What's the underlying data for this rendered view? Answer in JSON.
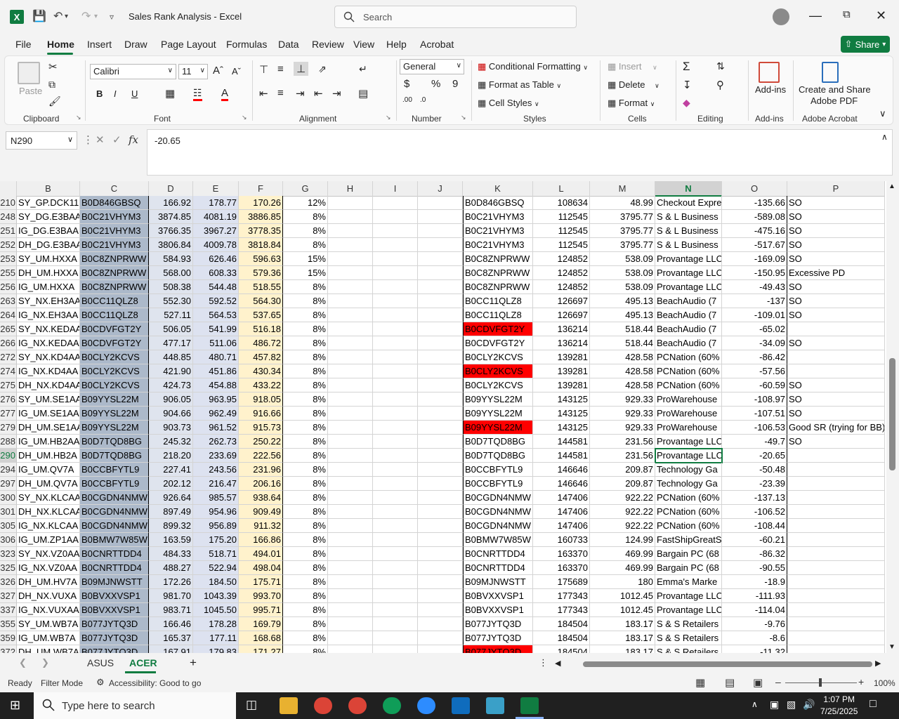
{
  "window": {
    "title": "Sales Rank Analysis  -  Excel",
    "search_placeholder": "Search"
  },
  "menu": {
    "items": [
      "File",
      "Home",
      "Insert",
      "Draw",
      "Page Layout",
      "Formulas",
      "Data",
      "Review",
      "View",
      "Help",
      "Acrobat"
    ],
    "active": "Home",
    "share": "Share"
  },
  "ribbon": {
    "clipboard": {
      "label": "Clipboard",
      "paste": "Paste"
    },
    "font": {
      "label": "Font",
      "name": "Calibri",
      "size": "11"
    },
    "alignment": {
      "label": "Alignment"
    },
    "number": {
      "label": "Number",
      "format": "General"
    },
    "styles": {
      "label": "Styles",
      "conditional": "Conditional Formatting",
      "format_table": "Format as Table",
      "cell_styles": "Cell Styles"
    },
    "cells": {
      "label": "Cells",
      "insert": "Insert",
      "delete": "Delete",
      "format": "Format"
    },
    "editing": {
      "label": "Editing"
    },
    "addins": {
      "label": "Add-ins",
      "button": "Add-ins"
    },
    "acrobat": {
      "label": "Adobe Acrobat",
      "button_line1": "Create and Share",
      "button_line2": "Adobe PDF"
    }
  },
  "formula_bar": {
    "name_box": "N290",
    "value": "-20.65"
  },
  "columns": [
    "B",
    "C",
    "D",
    "E",
    "F",
    "G",
    "H",
    "I",
    "J",
    "K",
    "L",
    "M",
    "N",
    "O",
    "P"
  ],
  "selected_column": "N",
  "selected_row": "290",
  "rows": [
    {
      "row": "210",
      "B": "SY_GP.DCK11.",
      "C": "B0D846GBSQ",
      "D": "166.92",
      "E": "178.77",
      "F": "170.26",
      "G": "12%",
      "K": "B0D846GBSQ",
      "L": "108634",
      "M": "48.99",
      "N": "Checkout Expre",
      "O": "-135.66",
      "P": "SO",
      "kred": false
    },
    {
      "row": "248",
      "B": "SY_DG.E3BAA",
      "C": "B0C21VHYM3",
      "D": "3874.85",
      "E": "4081.19",
      "F": "3886.85",
      "G": "8%",
      "K": "B0C21VHYM3",
      "L": "112545",
      "M": "3795.77",
      "N": "S & L Business",
      "O": "-589.08",
      "P": "SO",
      "kred": false
    },
    {
      "row": "251",
      "B": "IG_DG.E3BAA",
      "C": "B0C21VHYM3",
      "D": "3766.35",
      "E": "3967.27",
      "F": "3778.35",
      "G": "8%",
      "K": "B0C21VHYM3",
      "L": "112545",
      "M": "3795.77",
      "N": "S & L Business",
      "O": "-475.16",
      "P": "SO",
      "kred": false
    },
    {
      "row": "252",
      "B": "DH_DG.E3BAA",
      "C": "B0C21VHYM3",
      "D": "3806.84",
      "E": "4009.78",
      "F": "3818.84",
      "G": "8%",
      "K": "B0C21VHYM3",
      "L": "112545",
      "M": "3795.77",
      "N": "S & L Business",
      "O": "-517.67",
      "P": "SO",
      "kred": false
    },
    {
      "row": "253",
      "B": "SY_UM.HXXA",
      "C": "B0C8ZNPRWW",
      "D": "584.93",
      "E": "626.46",
      "F": "596.63",
      "G": "15%",
      "K": "B0C8ZNPRWW",
      "L": "124852",
      "M": "538.09",
      "N": "Provantage LLC",
      "O": "-169.09",
      "P": "SO",
      "kred": false
    },
    {
      "row": "255",
      "B": "DH_UM.HXXA",
      "C": "B0C8ZNPRWW",
      "D": "568.00",
      "E": "608.33",
      "F": "579.36",
      "G": "15%",
      "K": "B0C8ZNPRWW",
      "L": "124852",
      "M": "538.09",
      "N": "Provantage LLC",
      "O": "-150.95",
      "P": "Excessive PD",
      "kred": false
    },
    {
      "row": "256",
      "B": "IG_UM.HXXA",
      "C": "B0C8ZNPRWW",
      "D": "508.38",
      "E": "544.48",
      "F": "518.55",
      "G": "8%",
      "K": "B0C8ZNPRWW",
      "L": "124852",
      "M": "538.09",
      "N": "Provantage LLC",
      "O": "-49.43",
      "P": "SO",
      "kred": false
    },
    {
      "row": "263",
      "B": "SY_NX.EH3AA",
      "C": "B0CC11QLZ8",
      "D": "552.30",
      "E": "592.52",
      "F": "564.30",
      "G": "8%",
      "K": "B0CC11QLZ8",
      "L": "126697",
      "M": "495.13",
      "N": "BeachAudio (7",
      "O": "-137",
      "P": "SO",
      "kred": false
    },
    {
      "row": "264",
      "B": "IG_NX.EH3AA",
      "C": "B0CC11QLZ8",
      "D": "527.11",
      "E": "564.53",
      "F": "537.65",
      "G": "8%",
      "K": "B0CC11QLZ8",
      "L": "126697",
      "M": "495.13",
      "N": "BeachAudio (7",
      "O": "-109.01",
      "P": "SO",
      "kred": false
    },
    {
      "row": "265",
      "B": "SY_NX.KEDAA",
      "C": "B0CDVFGT2Y",
      "D": "506.05",
      "E": "541.99",
      "F": "516.18",
      "G": "8%",
      "K": "B0CDVFGT2Y",
      "L": "136214",
      "M": "518.44",
      "N": "BeachAudio (7",
      "O": "-65.02",
      "P": "",
      "kred": true
    },
    {
      "row": "266",
      "B": "IG_NX.KEDAA",
      "C": "B0CDVFGT2Y",
      "D": "477.17",
      "E": "511.06",
      "F": "486.72",
      "G": "8%",
      "K": "B0CDVFGT2Y",
      "L": "136214",
      "M": "518.44",
      "N": "BeachAudio (7",
      "O": "-34.09",
      "P": "SO",
      "kred": false
    },
    {
      "row": "272",
      "B": "SY_NX.KD4AA",
      "C": "B0CLY2KCVS",
      "D": "448.85",
      "E": "480.71",
      "F": "457.82",
      "G": "8%",
      "K": "B0CLY2KCVS",
      "L": "139281",
      "M": "428.58",
      "N": "PCNation (60%",
      "O": "-86.42",
      "P": "",
      "kred": false
    },
    {
      "row": "274",
      "B": "IG_NX.KD4AA",
      "C": "B0CLY2KCVS",
      "D": "421.90",
      "E": "451.86",
      "F": "430.34",
      "G": "8%",
      "K": "B0CLY2KCVS",
      "L": "139281",
      "M": "428.58",
      "N": "PCNation (60%",
      "O": "-57.56",
      "P": "",
      "kred": true
    },
    {
      "row": "275",
      "B": "DH_NX.KD4AA",
      "C": "B0CLY2KCVS",
      "D": "424.73",
      "E": "454.88",
      "F": "433.22",
      "G": "8%",
      "K": "B0CLY2KCVS",
      "L": "139281",
      "M": "428.58",
      "N": "PCNation (60%",
      "O": "-60.59",
      "P": "SO",
      "kred": false
    },
    {
      "row": "276",
      "B": "SY_UM.SE1AA",
      "C": "B09YYSL22M",
      "D": "906.05",
      "E": "963.95",
      "F": "918.05",
      "G": "8%",
      "K": "B09YYSL22M",
      "L": "143125",
      "M": "929.33",
      "N": "ProWarehouse",
      "O": "-108.97",
      "P": "SO",
      "kred": false
    },
    {
      "row": "277",
      "B": "IG_UM.SE1AA",
      "C": "B09YYSL22M",
      "D": "904.66",
      "E": "962.49",
      "F": "916.66",
      "G": "8%",
      "K": "B09YYSL22M",
      "L": "143125",
      "M": "929.33",
      "N": "ProWarehouse",
      "O": "-107.51",
      "P": "SO",
      "kred": false
    },
    {
      "row": "279",
      "B": "DH_UM.SE1AA",
      "C": "B09YYSL22M",
      "D": "903.73",
      "E": "961.52",
      "F": "915.73",
      "G": "8%",
      "K": "B09YYSL22M",
      "L": "143125",
      "M": "929.33",
      "N": "ProWarehouse",
      "O": "-106.53",
      "P": "Good SR (trying for BB)",
      "kred": true
    },
    {
      "row": "288",
      "B": "IG_UM.HB2AA",
      "C": "B0D7TQD8BG",
      "D": "245.32",
      "E": "262.73",
      "F": "250.22",
      "G": "8%",
      "K": "B0D7TQD8BG",
      "L": "144581",
      "M": "231.56",
      "N": "Provantage LLC",
      "O": "-49.7",
      "P": "SO",
      "kred": false
    },
    {
      "row": "290",
      "B": "DH_UM.HB2A",
      "C": "B0D7TQD8BG",
      "D": "218.20",
      "E": "233.69",
      "F": "222.56",
      "G": "8%",
      "K": "B0D7TQD8BG",
      "L": "144581",
      "M": "231.56",
      "N": "Provantage LLC",
      "O": "-20.65",
      "P": "",
      "kred": false
    },
    {
      "row": "294",
      "B": "IG_UM.QV7A",
      "C": "B0CCBFYTL9",
      "D": "227.41",
      "E": "243.56",
      "F": "231.96",
      "G": "8%",
      "K": "B0CCBFYTL9",
      "L": "146646",
      "M": "209.87",
      "N": "Technology Ga",
      "O": "-50.48",
      "P": "",
      "kred": false
    },
    {
      "row": "297",
      "B": "DH_UM.QV7A",
      "C": "B0CCBFYTL9",
      "D": "202.12",
      "E": "216.47",
      "F": "206.16",
      "G": "8%",
      "K": "B0CCBFYTL9",
      "L": "146646",
      "M": "209.87",
      "N": "Technology Ga",
      "O": "-23.39",
      "P": "",
      "kred": false
    },
    {
      "row": "300",
      "B": "SY_NX.KLCAA",
      "C": "B0CGDN4NMW",
      "D": "926.64",
      "E": "985.57",
      "F": "938.64",
      "G": "8%",
      "K": "B0CGDN4NMW",
      "L": "147406",
      "M": "922.22",
      "N": "PCNation (60%",
      "O": "-137.13",
      "P": "",
      "kred": false
    },
    {
      "row": "301",
      "B": "DH_NX.KLCAA",
      "C": "B0CGDN4NMW",
      "D": "897.49",
      "E": "954.96",
      "F": "909.49",
      "G": "8%",
      "K": "B0CGDN4NMW",
      "L": "147406",
      "M": "922.22",
      "N": "PCNation (60%",
      "O": "-106.52",
      "P": "",
      "kred": false
    },
    {
      "row": "305",
      "B": "IG_NX.KLCAA",
      "C": "B0CGDN4NMW",
      "D": "899.32",
      "E": "956.89",
      "F": "911.32",
      "G": "8%",
      "K": "B0CGDN4NMW",
      "L": "147406",
      "M": "922.22",
      "N": "PCNation (60%",
      "O": "-108.44",
      "P": "",
      "kred": false
    },
    {
      "row": "306",
      "B": "IG_UM.ZP1AA",
      "C": "B0BMW7W85W",
      "D": "163.59",
      "E": "175.20",
      "F": "166.86",
      "G": "8%",
      "K": "B0BMW7W85W",
      "L": "160733",
      "M": "124.99",
      "N": "FastShipGreatS",
      "O": "-60.21",
      "P": "",
      "kred": false
    },
    {
      "row": "323",
      "B": "SY_NX.VZ0AA",
      "C": "B0CNRTTDD4",
      "D": "484.33",
      "E": "518.71",
      "F": "494.01",
      "G": "8%",
      "K": "B0CNRTTDD4",
      "L": "163370",
      "M": "469.99",
      "N": "Bargain PC (68",
      "O": "-86.32",
      "P": "",
      "kred": false
    },
    {
      "row": "325",
      "B": "IG_NX.VZ0AA",
      "C": "B0CNRTTDD4",
      "D": "488.27",
      "E": "522.94",
      "F": "498.04",
      "G": "8%",
      "K": "B0CNRTTDD4",
      "L": "163370",
      "M": "469.99",
      "N": "Bargain PC (68",
      "O": "-90.55",
      "P": "",
      "kred": false
    },
    {
      "row": "326",
      "B": "DH_UM.HV7A",
      "C": "B09MJNWSTT",
      "D": "172.26",
      "E": "184.50",
      "F": "175.71",
      "G": "8%",
      "K": "B09MJNWSTT",
      "L": "175689",
      "M": "180",
      "N": "Emma's Marke",
      "O": "-18.9",
      "P": "",
      "kred": false
    },
    {
      "row": "327",
      "B": "DH_NX.VUXA",
      "C": "B0BVXXVSP1",
      "D": "981.70",
      "E": "1043.39",
      "F": "993.70",
      "G": "8%",
      "K": "B0BVXXVSP1",
      "L": "177343",
      "M": "1012.45",
      "N": "Provantage LLC",
      "O": "-111.93",
      "P": "",
      "kred": false
    },
    {
      "row": "337",
      "B": "IG_NX.VUXAA",
      "C": "B0BVXXVSP1",
      "D": "983.71",
      "E": "1045.50",
      "F": "995.71",
      "G": "8%",
      "K": "B0BVXXVSP1",
      "L": "177343",
      "M": "1012.45",
      "N": "Provantage LLC",
      "O": "-114.04",
      "P": "",
      "kred": false
    },
    {
      "row": "355",
      "B": "SY_UM.WB7A",
      "C": "B077JYTQ3D",
      "D": "166.46",
      "E": "178.28",
      "F": "169.79",
      "G": "8%",
      "K": "B077JYTQ3D",
      "L": "184504",
      "M": "183.17",
      "N": "S & S Retailers",
      "O": "-9.76",
      "P": "",
      "kred": false
    },
    {
      "row": "359",
      "B": "IG_UM.WB7A",
      "C": "B077JYTQ3D",
      "D": "165.37",
      "E": "177.11",
      "F": "168.68",
      "G": "8%",
      "K": "B077JYTQ3D",
      "L": "184504",
      "M": "183.17",
      "N": "S & S Retailers",
      "O": "-8.6",
      "P": "",
      "kred": false
    },
    {
      "row": "372",
      "B": "DH_UM.WB7A",
      "C": "B077JYTQ3D",
      "D": "167.91",
      "E": "179.83",
      "F": "171.27",
      "G": "8%",
      "K": "B077JYTQ3D",
      "L": "184504",
      "M": "183.17",
      "N": "S & S Retailers",
      "O": "-11.32",
      "P": "",
      "kred": true
    }
  ],
  "sheet_tabs": [
    "ASUS",
    "ACER"
  ],
  "active_tab": "ACER",
  "status": {
    "ready": "Ready",
    "filter": "Filter Mode",
    "accessibility": "Accessibility: Good to go",
    "zoom": "100%"
  },
  "taskbar": {
    "search_placeholder": "Type here to search",
    "time": "1:07 PM",
    "date": "7/25/2025"
  },
  "colors": {
    "accent": "#107c41",
    "c_fill": "#acb9ca",
    "f_fill": "#fff2cc",
    "red": "#ff0000"
  }
}
